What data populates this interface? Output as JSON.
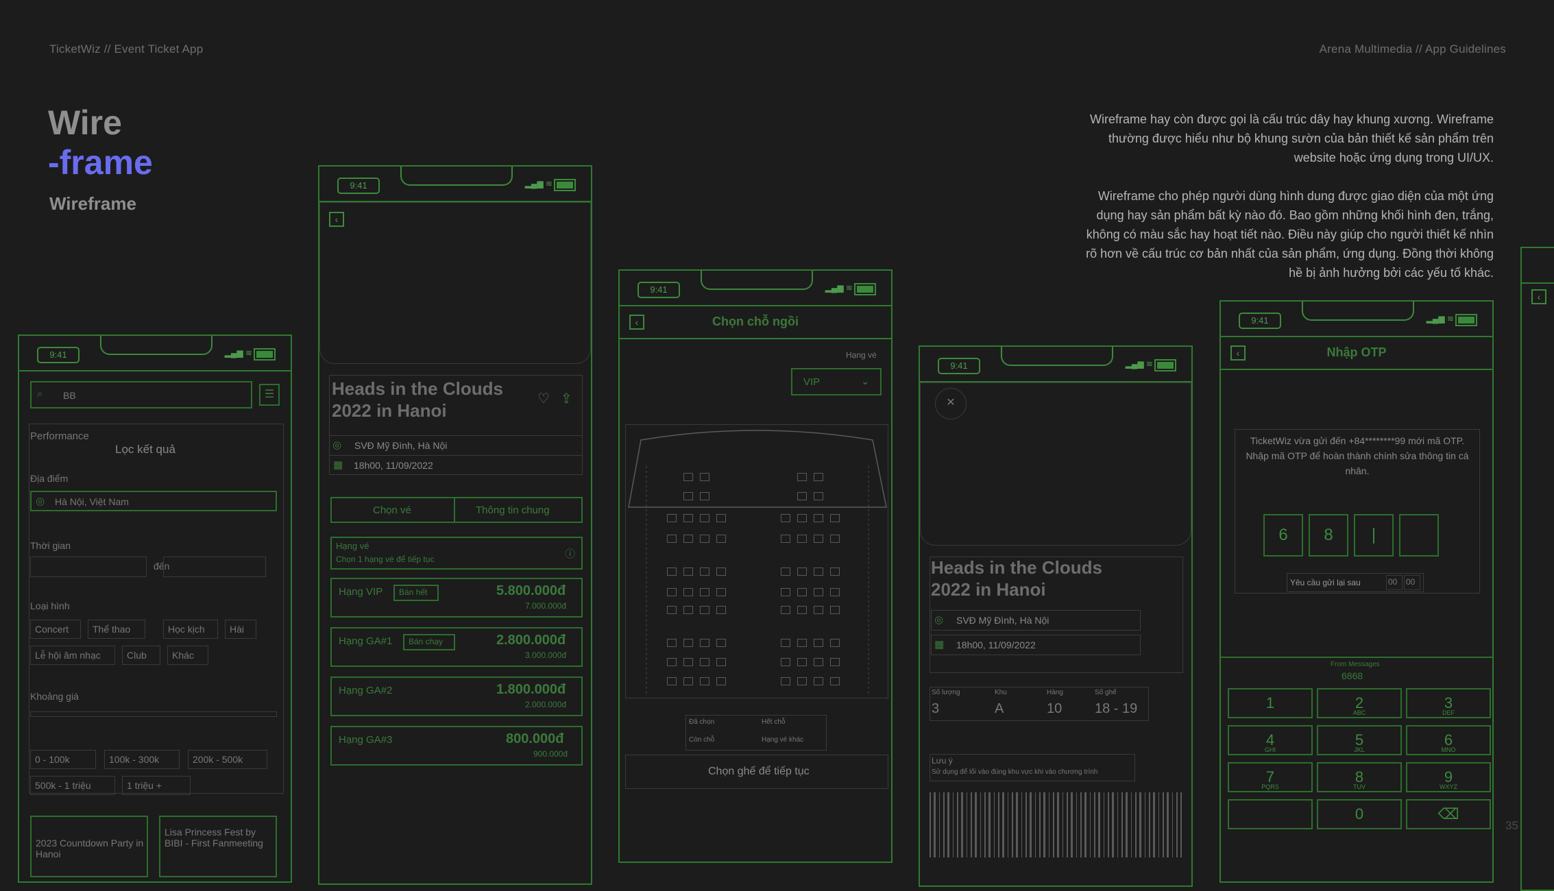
{
  "header": {
    "left": "TicketWiz // Event Ticket App",
    "right": "Arena Multimedia // App Guidelines"
  },
  "title": {
    "line1": "Wire",
    "line2": "-frame",
    "subtitle": "Wireframe"
  },
  "description": {
    "p1": "Wireframe hay còn được gọi là cấu trúc dây hay khung xương. Wireframe thường được hiểu như bộ khung sườn của bản thiết kế sản phẩm trên website hoặc ứng dụng trong UI/UX.",
    "p2": "Wireframe cho phép người dùng hình dung được giao diện của một ứng dụng hay sản phẩm bất kỳ nào đó. Bao gồm những khối hình đen, trắng, không có màu sắc hay hoạt tiết nào. Điều này giúp cho người thiết kế nhìn rõ hơn về cấu trúc cơ bản nhất của sản phẩm, ứng dụng. Đồng thời không hề bị ảnh hưởng bởi các yếu tố khác."
  },
  "status_time": "9:41",
  "screen1": {
    "search": "BB",
    "performance": "Performance",
    "filter_title": "Lọc kết quả",
    "location_label": "Địa điểm",
    "location_value": "Hà Nội, Việt Nam",
    "time_label": "Thời gian",
    "time_to": "đến",
    "type_label": "Loại hình",
    "tags": [
      "Concert",
      "Thể thao",
      "Học kịch",
      "Hài",
      "Lễ hội âm nhạc",
      "Club",
      "Khác"
    ],
    "price_label": "Khoảng giá",
    "prices": [
      "0 - 100k",
      "100k - 300k",
      "200k - 500k",
      "500k - 1 triệu",
      "1 triệu +"
    ],
    "card1": "2023 Countdown Party in Hanoi",
    "card2": "Lisa Princess Fest by BIBI - First Fanmeeting"
  },
  "screen2": {
    "event_title": "Heads in the Clouds 2022 in Hanoi",
    "venue": "SVĐ Mỹ Đình, Hà Nội",
    "datetime": "18h00, 11/09/2022",
    "tab1": "Chọn vé",
    "tab2": "Thông tin chung",
    "section": "Hạng vé",
    "section_hint": "Chọn 1 hạng vé để tiếp tục",
    "tickets": [
      {
        "name": "Hạng VIP",
        "badge": "Bán hết",
        "price": "5.800.000đ",
        "old": "7.000.000đ"
      },
      {
        "name": "Hạng GA#1",
        "badge": "Bán chạy",
        "price": "2.800.000đ",
        "old": "3.000.000đ"
      },
      {
        "name": "Hạng GA#2",
        "badge": "",
        "price": "1.800.000đ",
        "old": "2.000.000đ"
      },
      {
        "name": "Hạng GA#3",
        "badge": "",
        "price": "800.000đ",
        "old": "900.000đ"
      }
    ]
  },
  "screen3": {
    "title": "Chọn chỗ ngồi",
    "seat_type_label": "Hạng vé",
    "seat_type_value": "VIP",
    "legend": [
      "Đã chọn",
      "Hết chỗ",
      "Còn chỗ",
      "Hạng vé khác"
    ],
    "cta": "Chọn ghế để tiếp tục"
  },
  "screen4": {
    "event_title": "Heads in the Clouds 2022 in Hanoi",
    "venue": "SVĐ Mỹ Đình, Hà Nội",
    "datetime": "18h00, 11/09/2022",
    "col1": "Số lượng",
    "col1_v": "3",
    "col2": "Khu",
    "col2_v": "A",
    "col3": "Hàng",
    "col3_v": "10",
    "col4": "Số ghế",
    "col4_v": "18 - 19",
    "note_title": "Lưu ý",
    "note_text": "Sử dụng để lối vào đúng khu vực khi vào chương trình"
  },
  "screen5": {
    "title": "Nhập OTP",
    "message": "TicketWiz vừa gửi đến +84********99 mới mã OTP. Nhập mã OTP để hoàn thành chính sửa thông tin cá nhân.",
    "otp": [
      "6",
      "8",
      "|",
      ""
    ],
    "resend": "Yêu cầu gửi lại sau",
    "timer_m": "00",
    "timer_s": "00",
    "suggest_label": "From Messages",
    "suggest_code": "6868",
    "keys": [
      {
        "n": "1",
        "l": ""
      },
      {
        "n": "2",
        "l": "ABC"
      },
      {
        "n": "3",
        "l": "DEF"
      },
      {
        "n": "4",
        "l": "GHI"
      },
      {
        "n": "5",
        "l": "JKL"
      },
      {
        "n": "6",
        "l": "MNO"
      },
      {
        "n": "7",
        "l": "PQRS"
      },
      {
        "n": "8",
        "l": "TUV"
      },
      {
        "n": "9",
        "l": "WXYZ"
      },
      {
        "n": "",
        "l": ""
      },
      {
        "n": "0",
        "l": ""
      },
      {
        "n": "⌫",
        "l": ""
      }
    ]
  },
  "page_number": "35"
}
